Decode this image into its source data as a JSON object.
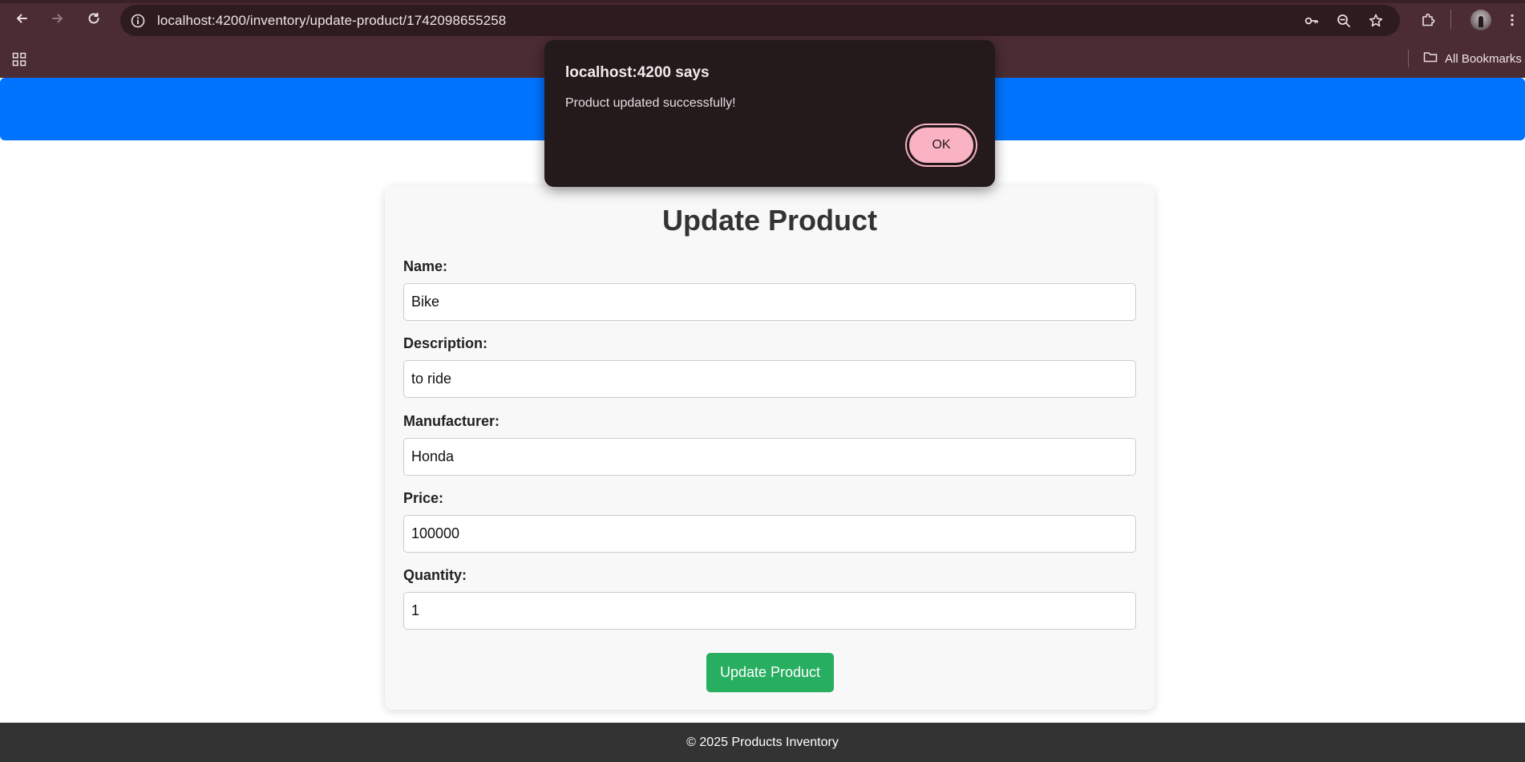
{
  "browser": {
    "url": "localhost:4200/inventory/update-product/1742098655258",
    "bookmarks_label": "All Bookmarks",
    "icons": {
      "back": "back-arrow-icon",
      "forward": "forward-arrow-icon",
      "reload": "reload-icon",
      "site_info": "info-icon",
      "password": "key-icon",
      "zoom": "zoom-out-icon",
      "bookmark": "star-icon",
      "extensions": "puzzle-icon",
      "menu": "kebab-menu-icon",
      "apps": "apps-grid-icon",
      "folder": "folder-icon"
    }
  },
  "dialog": {
    "title": "localhost:4200 says",
    "message": "Product updated successfully!",
    "ok_label": "OK"
  },
  "form": {
    "title": "Update Product",
    "fields": [
      {
        "label": "Name:",
        "value": "Bike"
      },
      {
        "label": "Description:",
        "value": "to ride"
      },
      {
        "label": "Manufacturer:",
        "value": "Honda"
      },
      {
        "label": "Price:",
        "value": "100000"
      },
      {
        "label": "Quantity:",
        "value": "1"
      }
    ],
    "submit_label": "Update Product"
  },
  "footer": {
    "text": "© 2025 Products Inventory"
  },
  "colors": {
    "header": "#0074ff",
    "submit_button": "#28ae60",
    "dialog_ok": "#f9b3c2",
    "footer": "#333333",
    "chrome": "#4b2c33"
  }
}
